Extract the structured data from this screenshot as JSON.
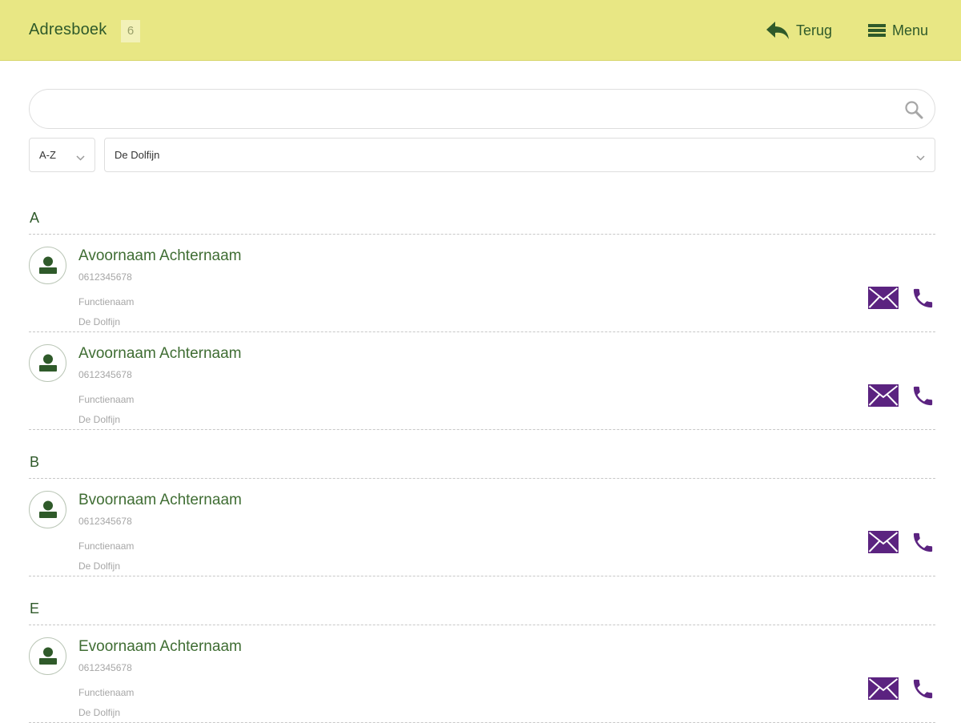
{
  "header": {
    "title": "Adresboek",
    "count": "6",
    "back_label": "Terug",
    "menu_label": "Menu"
  },
  "search": {
    "value": "",
    "placeholder": ""
  },
  "filters": {
    "sort": "A-Z",
    "location": "De Dolfijn"
  },
  "groups": [
    {
      "letter": "A",
      "contacts": [
        {
          "name": "Avoornaam Achternaam",
          "phone": "0612345678",
          "function": "Functienaam",
          "organization": "De Dolfijn"
        },
        {
          "name": "Avoornaam Achternaam",
          "phone": "0612345678",
          "function": "Functienaam",
          "organization": "De Dolfijn"
        }
      ]
    },
    {
      "letter": "B",
      "contacts": [
        {
          "name": "Bvoornaam Achternaam",
          "phone": "0612345678",
          "function": "Functienaam",
          "organization": "De Dolfijn"
        }
      ]
    },
    {
      "letter": "E",
      "contacts": [
        {
          "name": "Evoornaam Achternaam",
          "phone": "0612345678",
          "function": "Functienaam",
          "organization": "De Dolfijn"
        }
      ]
    }
  ],
  "colors": {
    "header_bg": "#e8e784",
    "primary_green": "#2f5a2a",
    "action_purple": "#5b2380"
  },
  "icons": {
    "back": "reply-arrow-icon",
    "menu": "hamburger-icon",
    "search": "magnifier-icon",
    "avatar": "person-icon",
    "mail": "envelope-icon",
    "call": "phone-icon"
  }
}
